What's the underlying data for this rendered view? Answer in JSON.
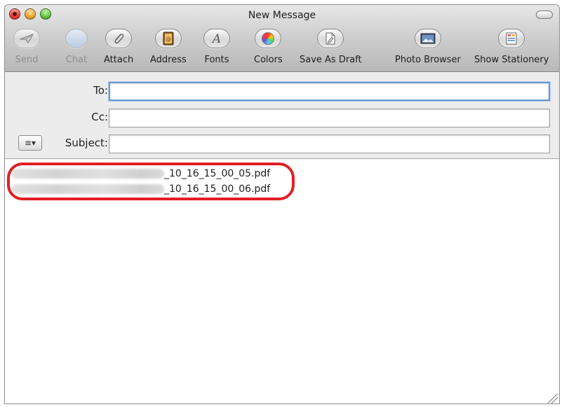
{
  "window": {
    "title": "New Message"
  },
  "toolbar": {
    "items": [
      {
        "label": "Send",
        "icon": "send-icon",
        "enabled": false
      },
      {
        "label": "Chat",
        "icon": "chat-icon",
        "enabled": false
      },
      {
        "label": "Attach",
        "icon": "paperclip-icon",
        "enabled": true
      },
      {
        "label": "Address",
        "icon": "address-book-icon",
        "enabled": true
      },
      {
        "label": "Fonts",
        "icon": "fonts-icon",
        "enabled": true
      },
      {
        "label": "Colors",
        "icon": "color-wheel-icon",
        "enabled": true
      },
      {
        "label": "Save As Draft",
        "icon": "draft-icon",
        "enabled": true
      },
      {
        "label": "Photo Browser",
        "icon": "photo-icon",
        "enabled": true
      },
      {
        "label": "Show Stationery",
        "icon": "stationery-icon",
        "enabled": true
      }
    ]
  },
  "headers": {
    "to_label": "To:",
    "to_value": "",
    "cc_label": "Cc:",
    "cc_value": "",
    "subject_label": "Subject:",
    "subject_value": "",
    "menu_glyph": "≡▾"
  },
  "attachments": [
    {
      "name_suffix": "_10_16_15_00_05.pdf"
    },
    {
      "name_suffix": "_10_16_15_00_06.pdf"
    }
  ],
  "colors": {
    "highlight": "#e11f25",
    "focus_ring": "#6d9ad0"
  }
}
